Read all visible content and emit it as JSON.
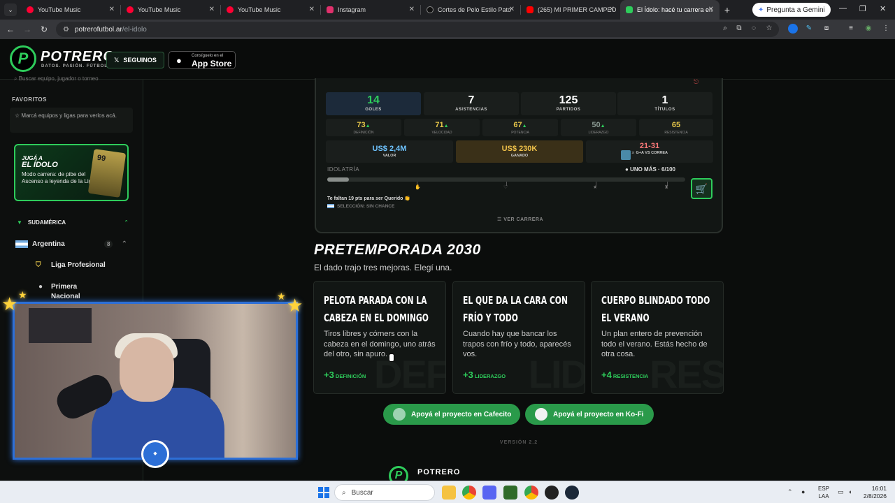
{
  "browser": {
    "tabs": [
      {
        "title": "YouTube Music",
        "color": "#ff0033"
      },
      {
        "title": "YouTube Music",
        "color": "#ff0033"
      },
      {
        "title": "YouTube Music",
        "color": "#ff0033"
      },
      {
        "title": "Instagram",
        "color": "#e1306c"
      },
      {
        "title": "Cortes de Pelo Estilo Pato",
        "color": "#111111"
      },
      {
        "title": "(265) MI PRIMER CAMPEO",
        "color": "#ff0000"
      },
      {
        "title": "El Ídolo: hacé tu carrera en",
        "color": "#2ecc5b"
      }
    ],
    "tab_close": "✕",
    "new_tab": "+",
    "gemini_label": "Pregunta a Gemini",
    "url_host": "potrerofutbol.ar",
    "url_path": "/el-idolo"
  },
  "site": {
    "logo_mark": "P",
    "logo_text": "POTRERO",
    "tagline": "DATOS. PASIÓN. FÚTBOL.",
    "follow_label": "SEGUINOS",
    "appstore_small": "Consíguelo en el",
    "appstore_big": "App Store"
  },
  "sidebar": {
    "search_placeholder": "Buscar equipo, jugador o torneo",
    "favorites_title": "FAVORITOS",
    "favorites_empty": "Marcá equipos y ligas para verlos acá.",
    "promo_kicker": "JUGÁ A",
    "promo_title": "EL ÍDOLO",
    "promo_desc": "Modo carrera: de pibe del Ascenso a leyenda de la Liga",
    "promo_card_rating": "99",
    "region": "SUDAMÉRICA",
    "country": "Argentina",
    "country_count": "8",
    "leagues": [
      "Liga Profesional",
      "Primera Nacional"
    ]
  },
  "career": {
    "stats": [
      {
        "value": "14",
        "label": "GOLES"
      },
      {
        "value": "7",
        "label": "ASISTENCIAS"
      },
      {
        "value": "125",
        "label": "PARTIDOS"
      },
      {
        "value": "1",
        "label": "TÍTULOS"
      }
    ],
    "attributes": [
      {
        "value": "73",
        "label": "DEFINICIÓN",
        "color": "#e8c84a"
      },
      {
        "value": "71",
        "label": "VELOCIDAD",
        "color": "#e8c84a"
      },
      {
        "value": "67",
        "label": "POTENCIA",
        "color": "#e8c84a"
      },
      {
        "value": "50",
        "label": "LIDERAZGO",
        "color": "#8a9a92"
      },
      {
        "value": "65",
        "label": "RESISTENCIA",
        "color": "#e8c84a"
      }
    ],
    "money": [
      {
        "value": "US$ 2,4M",
        "label": "VALOR",
        "color": "#6ec3ff"
      },
      {
        "value": "US$ 230K",
        "label": "GANADO",
        "color": "#f0c24a"
      },
      {
        "value": "21-31",
        "label": "G+A VS CORREA",
        "color": "#ff7a7a"
      }
    ],
    "idolatry_title": "IDOLATRÍA",
    "idolatry_level": "● UNO MÁS · 6/100",
    "idolatry_progress": 0.06,
    "points_msg": "Te faltan 19 pts para ser Querido 👏",
    "selection_msg": "SELECCIÓN: SIN CHANCE",
    "view_career": "☰  VER CARRERA"
  },
  "preseason": {
    "title": "PRETEMPORADA 2030",
    "subtitle": "El dado trajo tres mejoras. Elegí una.",
    "options": [
      {
        "title": "PELOTA PARADA CON LA CABEZA EN EL DOMINGO",
        "desc": "Tiros libres y córners con la cabeza en el domingo, uno atrás del otro, sin apuro.",
        "bonus_value": "+3",
        "bonus_label": "DEFINICIÓN",
        "watermark": "DEF"
      },
      {
        "title": "EL QUE DA LA CARA CON FRÍO Y TODO",
        "desc": "Cuando hay que bancar los trapos con frío y todo, aparecés vos.",
        "bonus_value": "+3",
        "bonus_label": "LIDERAZGO",
        "watermark": "LID"
      },
      {
        "title": "CUERPO BLINDADO TODO EL VERANO",
        "desc": "Un plan entero de prevención todo el verano. Estás hecho de otra cosa.",
        "bonus_value": "+4",
        "bonus_label": "RESISTENCIA",
        "watermark": "RES"
      }
    ]
  },
  "donate": {
    "cafecito": "Apoyá el proyecto en Cafecito",
    "kofi": "Apoyá el proyecto en Ko-Fi"
  },
  "footer": {
    "version": "VERSIÓN 2.2",
    "brand": "POTRERO"
  },
  "taskbar": {
    "search": "Buscar",
    "lang1": "ESP",
    "lang2": "LAA",
    "time": "16:01",
    "date": "2/8/2026"
  }
}
